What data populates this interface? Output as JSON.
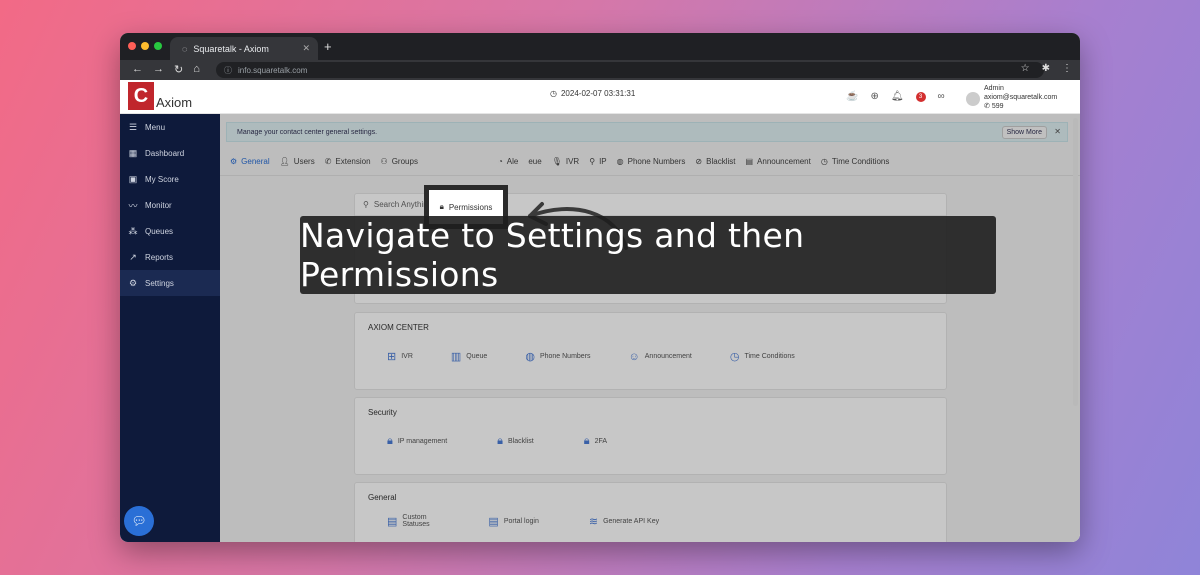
{
  "browser": {
    "tab_title": "Squaretalk - Axiom",
    "url": "info.squaretalk.com"
  },
  "app": {
    "logo_text": "Axiom",
    "datetime": "2024-02-07 03:31:31",
    "notification_count": "3",
    "user_name": "Admin",
    "user_email": "axiom@squaretalk.com",
    "user_ext": "599"
  },
  "sidebar": {
    "items": [
      {
        "label": "Menu",
        "icon": "menu-icon"
      },
      {
        "label": "Dashboard",
        "icon": "dashboard-icon"
      },
      {
        "label": "My Score",
        "icon": "score-icon"
      },
      {
        "label": "Monitor",
        "icon": "monitor-icon"
      },
      {
        "label": "Queues",
        "icon": "queues-icon"
      },
      {
        "label": "Reports",
        "icon": "reports-icon"
      },
      {
        "label": "Settings",
        "icon": "gear-icon"
      }
    ]
  },
  "banner": {
    "text": "Manage your contact center general settings.",
    "show_more": "Show More"
  },
  "tabs": {
    "general": "General",
    "users": "Users",
    "extension": "Extension",
    "groups": "Groups",
    "permissions": "Permissions",
    "alerts": "Ale",
    "queue": "eue",
    "ivr": "IVR",
    "ip": "IP",
    "phone_numbers": "Phone Numbers",
    "blacklist": "Blacklist",
    "announcement": "Announcement",
    "time_conditions": "Time Conditions"
  },
  "search": {
    "placeholder": "Search Anything"
  },
  "sections": {
    "axiom_center": {
      "title": "AXIOM CENTER",
      "items": [
        "IVR",
        "Queue",
        "Phone Numbers",
        "Announcement",
        "Time Conditions"
      ]
    },
    "security": {
      "title": "Security",
      "items": [
        "IP management",
        "Blacklist",
        "2FA"
      ]
    },
    "general": {
      "title": "General",
      "items": [
        "Custom Statuses",
        "Portal login",
        "Generate API Key"
      ]
    }
  },
  "caption": "Navigate to Settings and then Permissions",
  "colors": {
    "brand_red": "#c0262c",
    "sidebar_bg": "#0e1a3b",
    "accent_blue": "#2a6fd6"
  }
}
